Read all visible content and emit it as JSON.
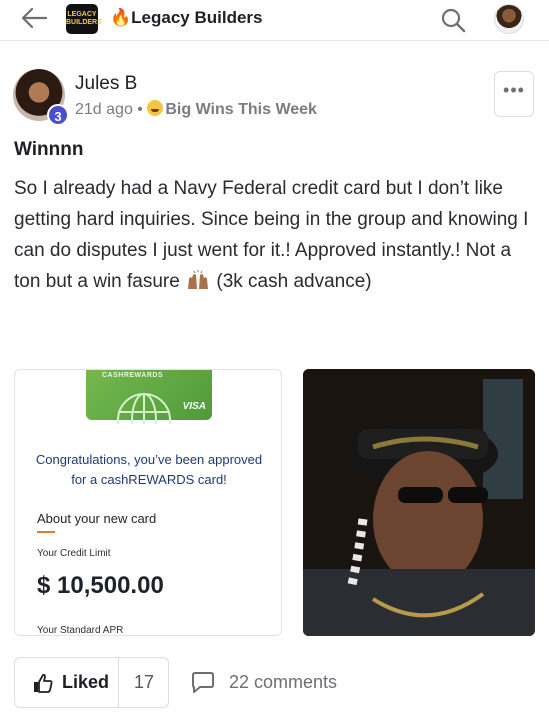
{
  "header": {
    "logo_text": "LEGACY BUILDERS",
    "title": "Legacy Builders",
    "title_emoji": "🔥"
  },
  "post": {
    "author": "Jules B",
    "level": "3",
    "time_ago": "21d ago",
    "separator": "•",
    "category": "Big Wins This Week",
    "more_label": "•••",
    "title": "Winnnn",
    "body_part1": "So I already had a Navy Federal credit card but I don’t like getting hard inquiries. Since being in the group and knowing I can do disputes I just went for it.! Approved instantly.! Not a ton but a win fasure",
    "body_part2": " (3k cash advance)"
  },
  "approval_image": {
    "card_brand": "CASHREWARDS",
    "card_network": "VISA",
    "congrats_line1": "Congratulations, you’ve been approved",
    "congrats_line2": "for a cashREWARDS card!",
    "about_heading": "About your new card",
    "limit_label": "Your Credit Limit",
    "limit_value": "$ 10,500.00",
    "apr_label": "Your Standard APR"
  },
  "actions": {
    "like_label": "Liked",
    "like_count": "17",
    "comments_label": "22 comments"
  },
  "colors": {
    "level_badge": "#4a4fd1",
    "accent_orange": "#e07a2d",
    "card_green": "#5aa642",
    "congrats_text": "#1d3b73"
  },
  "icons": {
    "back": "back-arrow-icon",
    "search": "search-icon",
    "like": "thumbs-up-icon",
    "comment": "comment-bubble-icon",
    "more": "more-horizontal-icon"
  }
}
